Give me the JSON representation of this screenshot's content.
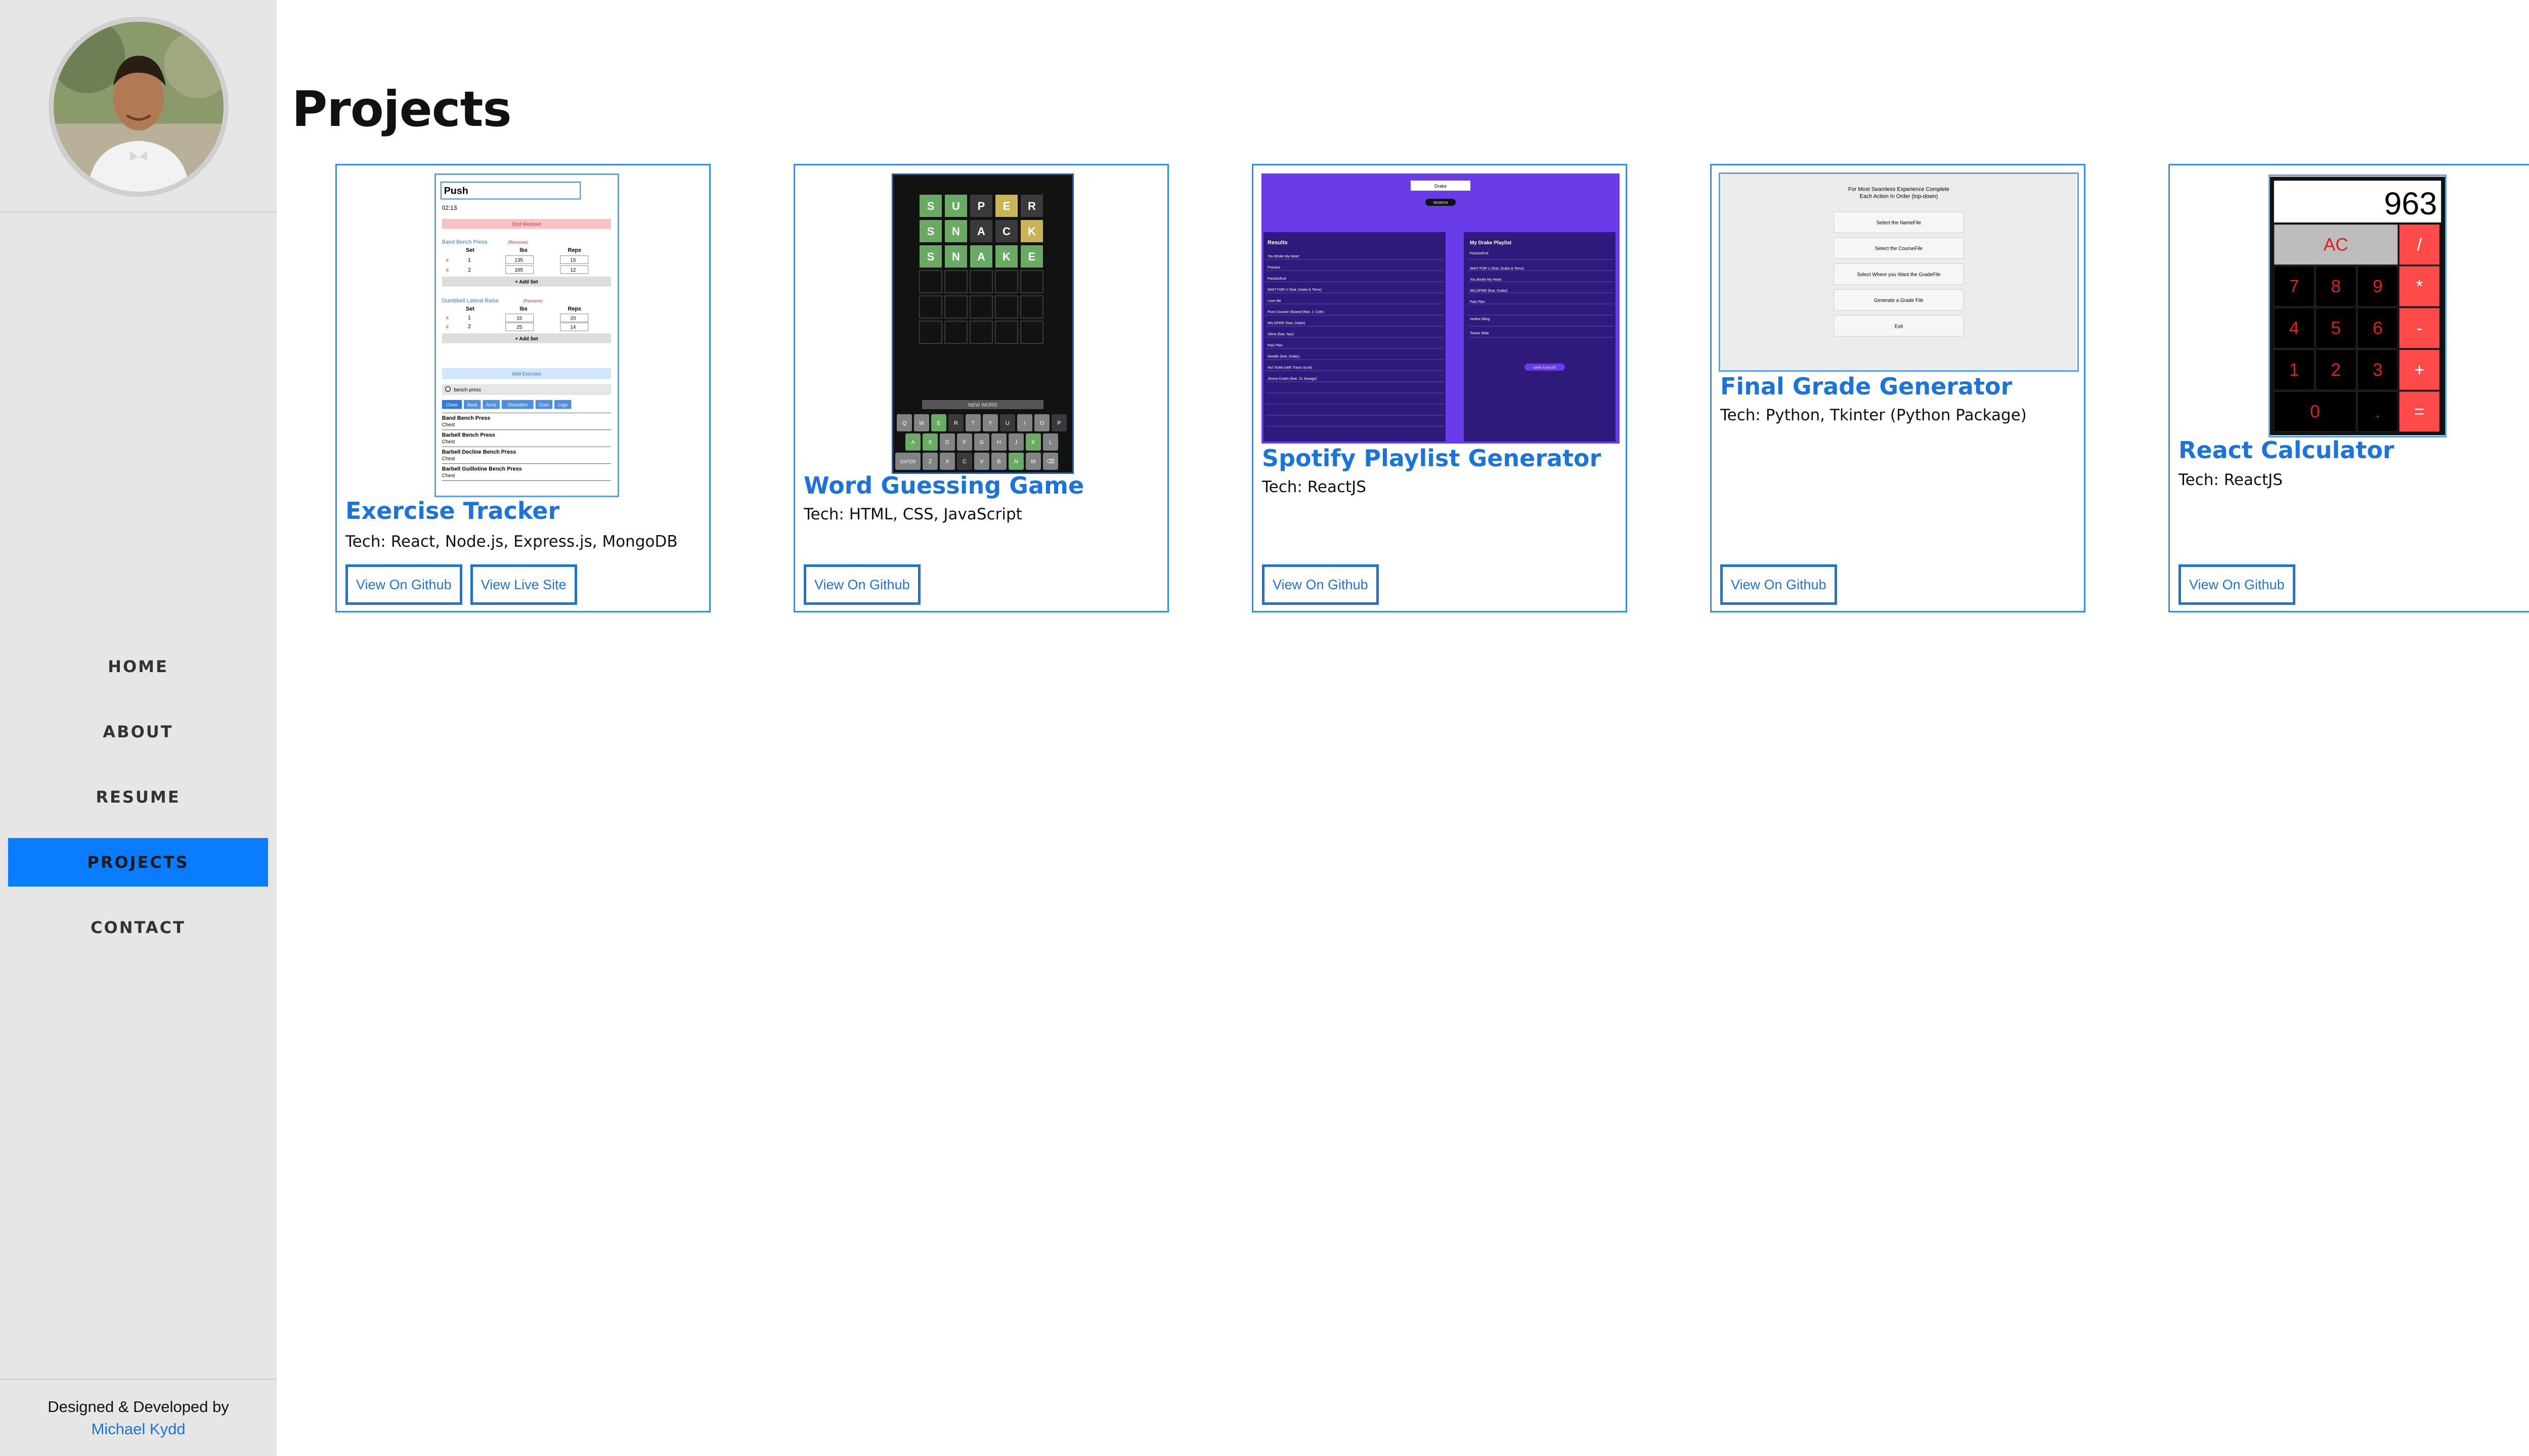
{
  "sidebar": {
    "nav": [
      {
        "label": "HOME",
        "active": false
      },
      {
        "label": "ABOUT",
        "active": false
      },
      {
        "label": "RESUME",
        "active": false
      },
      {
        "label": "PROJECTS",
        "active": true
      },
      {
        "label": "CONTACT",
        "active": false
      }
    ],
    "footer": {
      "line1": "Designed & Developed by",
      "author": "Michael Kydd"
    }
  },
  "main": {
    "title": "Projects",
    "projects": [
      {
        "title": "Exercise Tracker",
        "tech": "Tech: React, Node.js, Express.js, MongoDB",
        "buttons": [
          "View On Github",
          "View Live Site"
        ],
        "thumb": {
          "workout": "Push",
          "timer": "02:13",
          "end": "End Workout",
          "ex1": "Band Bench Press",
          "ex2": "Dumbbell Lateral Raise",
          "remove": "(Remove)",
          "set_col": "Set",
          "lbs_col": "lbs",
          "reps_col": "Reps",
          "add_set": "+ Add Set",
          "add_exercise": "Add Exercise",
          "search": "bench press",
          "filters": [
            "Chest",
            "Back",
            "Arms",
            "Shoulders",
            "Core",
            "Legs"
          ],
          "results": [
            {
              "name": "Band Bench Press",
              "cat": "Chest"
            },
            {
              "name": "Barbell Bench Press",
              "cat": "Chest"
            },
            {
              "name": "Barbell Decline Bench Press",
              "cat": "Chest"
            },
            {
              "name": "Barbell Guillotine Bench Press",
              "cat": "Chest"
            }
          ]
        }
      },
      {
        "title": "Word Guessing Game",
        "tech": "Tech: HTML, CSS, JavaScript",
        "buttons": [
          "View On Github"
        ],
        "thumb": {
          "rows": [
            "SUPER",
            "SNACK",
            "SNAKE"
          ],
          "new_word": "NEW WORD",
          "enter": "ENTER"
        }
      },
      {
        "title": "Spotify Playlist Generator",
        "tech": "Tech: ReactJS",
        "buttons": [
          "View On Github"
        ],
        "thumb": {
          "results": "Results",
          "playlist": "My Drake Playlist"
        }
      },
      {
        "title": "Final Grade Generator",
        "tech": "Tech: Python, Tkinter (Python Package)",
        "buttons": [
          "View On Github"
        ],
        "thumb": {
          "header1": "For Most Seamless Experience Complete",
          "header2": "Each Action In Order (top-down)",
          "actions": [
            "Select the NameFile",
            "Select the CourseFile",
            "Select Where you Want the GradeFile",
            "Generate a Grade File",
            "Exit"
          ]
        }
      },
      {
        "title": "React Calculator",
        "tech": "Tech: ReactJS",
        "buttons": [
          "View On Github"
        ],
        "thumb": {
          "display": "963",
          "keys": [
            "AC",
            "/",
            "7",
            "8",
            "9",
            "*",
            "4",
            "5",
            "6",
            "-",
            "1",
            "2",
            "3",
            "+",
            "0",
            ".",
            "="
          ]
        }
      }
    ]
  },
  "colors": {
    "accent": "#1a74d9",
    "nav_active": "#0a7cff",
    "sidebar_bg": "#e6e6e6",
    "card_border": "#2f8ff0"
  }
}
